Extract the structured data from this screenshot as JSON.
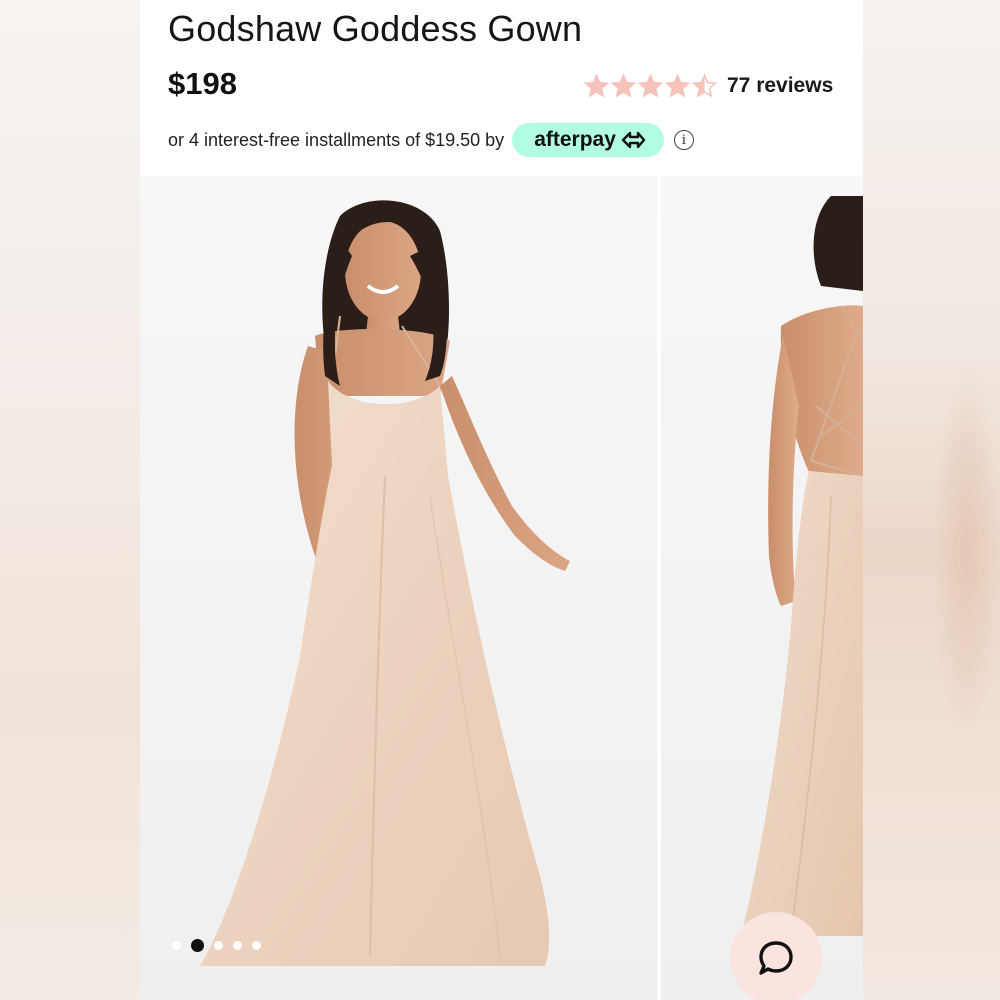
{
  "product": {
    "title": "Godshaw Goddess Gown",
    "price": "$198",
    "rating": 4.5,
    "rating_max": 5,
    "review_count": "77 reviews"
  },
  "installments": {
    "text": "or 4 interest-free installments of $19.50 by",
    "provider": "afterpay",
    "info_glyph": "i"
  },
  "gallery": {
    "images": [
      {
        "alt": "Model wearing champagne satin gown, front view"
      },
      {
        "alt": "Model wearing champagne satin gown, back view with lace-up straps"
      }
    ],
    "dots": 5,
    "active_index": 1
  },
  "colors": {
    "star_fill": "#f6c3bb",
    "afterpay_mint": "#b2fce4",
    "chat_bg": "#fbe3df",
    "gown": "#efd7c4"
  },
  "icons": {
    "star": "star-icon",
    "afterpay_logo": "afterpay-arrow-icon",
    "info": "info-icon",
    "chat": "chat-bubble-icon"
  }
}
